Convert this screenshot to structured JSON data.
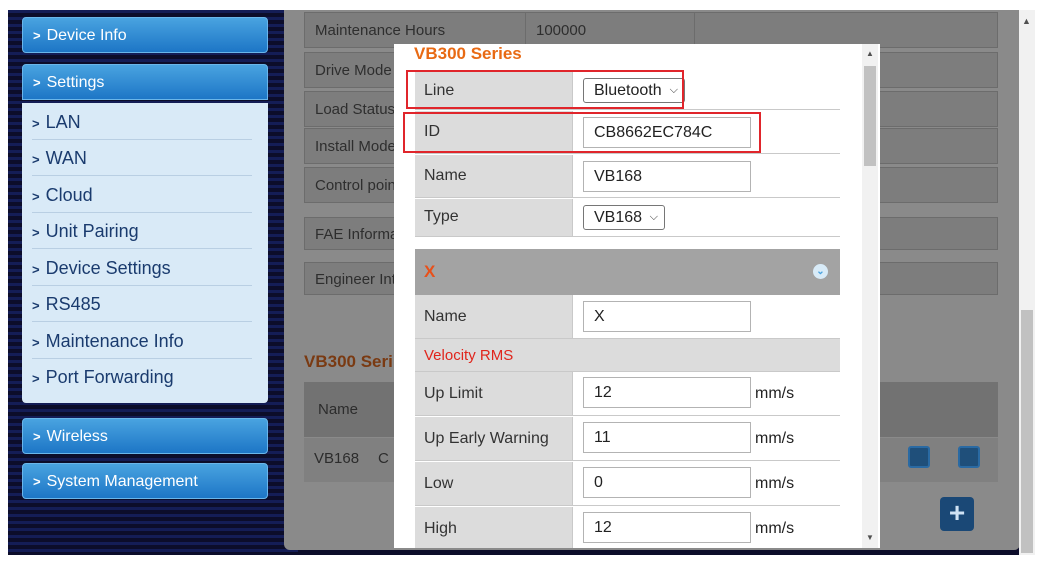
{
  "sidebar": {
    "device_info": "Device Info",
    "settings": "Settings",
    "items": [
      "LAN",
      "WAN",
      "Cloud",
      "Unit Pairing",
      "Device Settings",
      "RS485",
      "Maintenance Info",
      "Port Forwarding"
    ],
    "wireless": "Wireless",
    "system_management": "System Management"
  },
  "background": {
    "rows": [
      {
        "label": "Maintenance Hours",
        "value": "100000"
      },
      {
        "label": "Drive Mode",
        "value": ""
      },
      {
        "label": "Load Status",
        "value": ""
      },
      {
        "label": "Install Mode",
        "value": ""
      },
      {
        "label": "Control poin",
        "value": ""
      },
      {
        "label": "FAE Informa",
        "value": ""
      },
      {
        "label": "Engineer Int",
        "value": ""
      }
    ],
    "section_title": "VB300 Seri",
    "table_header": "Name",
    "table_row": {
      "name": "VB168",
      "col2": "C"
    }
  },
  "modal": {
    "title": "VB300 Series",
    "line_label": "Line",
    "line_value": "Bluetooth",
    "id_label": "ID",
    "id_value": "CB8662EC784C",
    "name_label": "Name",
    "name_value": "VB168",
    "type_label": "Type",
    "type_value": "VB168",
    "axis_label": "X",
    "axis_name_label": "Name",
    "axis_name_value": "X",
    "velocity_section": "Velocity RMS",
    "up_limit_label": "Up Limit",
    "up_limit_value": "12",
    "up_early_label": "Up Early Warning",
    "up_early_value": "11",
    "low_label": "Low",
    "low_value": "0",
    "high_label": "High",
    "high_value": "12",
    "unit": "mm/s"
  },
  "colors": {
    "title_orange": "#e86a14",
    "highlight_red": "#e0252b",
    "sidebar_blue": "#1d76c6"
  }
}
